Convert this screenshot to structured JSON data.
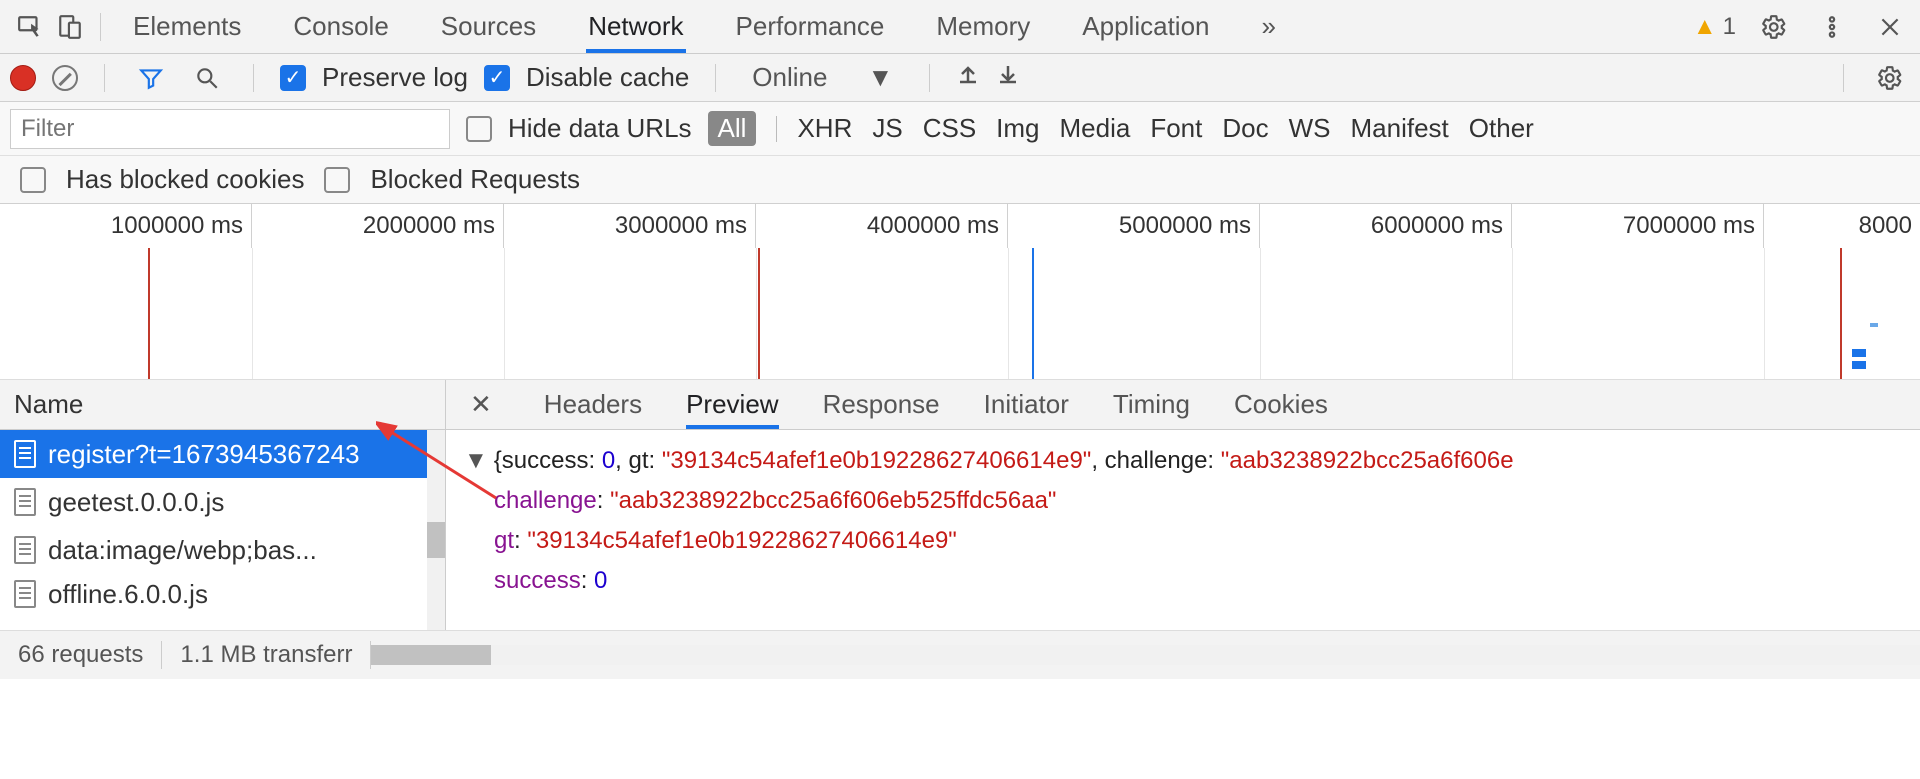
{
  "panelTabs": [
    "Elements",
    "Console",
    "Sources",
    "Network",
    "Performance",
    "Memory",
    "Application"
  ],
  "activePanel": "Network",
  "warnings": "1",
  "netToolbar": {
    "preserveLog": "Preserve log",
    "disableCache": "Disable cache",
    "throttling": "Online"
  },
  "filterRow": {
    "placeholder": "Filter",
    "hideDataUrls": "Hide data URLs",
    "types": [
      "All",
      "XHR",
      "JS",
      "CSS",
      "Img",
      "Media",
      "Font",
      "Doc",
      "WS",
      "Manifest",
      "Other"
    ]
  },
  "blockedRow": {
    "hasBlockedCookies": "Has blocked cookies",
    "blockedRequests": "Blocked Requests"
  },
  "timelineTicks": [
    "1000000 ms",
    "2000000 ms",
    "3000000 ms",
    "4000000 ms",
    "5000000 ms",
    "6000000 ms",
    "7000000 ms",
    "8000"
  ],
  "reqHeader": "Name",
  "requests": [
    {
      "name": "register?t=1673945367243",
      "selected": true
    },
    {
      "name": "geetest.0.0.0.js",
      "selected": false
    },
    {
      "name": "data:image/webp;bas...",
      "selected": false
    },
    {
      "name": "offline.6.0.0.js",
      "selected": false
    }
  ],
  "detailTabs": [
    "Headers",
    "Preview",
    "Response",
    "Initiator",
    "Timing",
    "Cookies"
  ],
  "activeDetailTab": "Preview",
  "preview": {
    "summaryPrefix": "{success: ",
    "summarySuccess": "0",
    "summaryGtLabel": ", gt: ",
    "summaryGt": "\"39134c54afef1e0b19228627406614e9\"",
    "summaryChLabel": ", challenge: ",
    "summaryCh": "\"aab3238922bcc25a6f606e",
    "rows": [
      {
        "k": "challenge",
        "v": "\"aab3238922bcc25a6f606eb525ffdc56aa\"",
        "t": "s"
      },
      {
        "k": "gt",
        "v": "\"39134c54afef1e0b19228627406614e9\"",
        "t": "s"
      },
      {
        "k": "success",
        "v": "0",
        "t": "n"
      }
    ]
  },
  "status": {
    "requests": "66 requests",
    "transferred": "1.1 MB transferr"
  }
}
